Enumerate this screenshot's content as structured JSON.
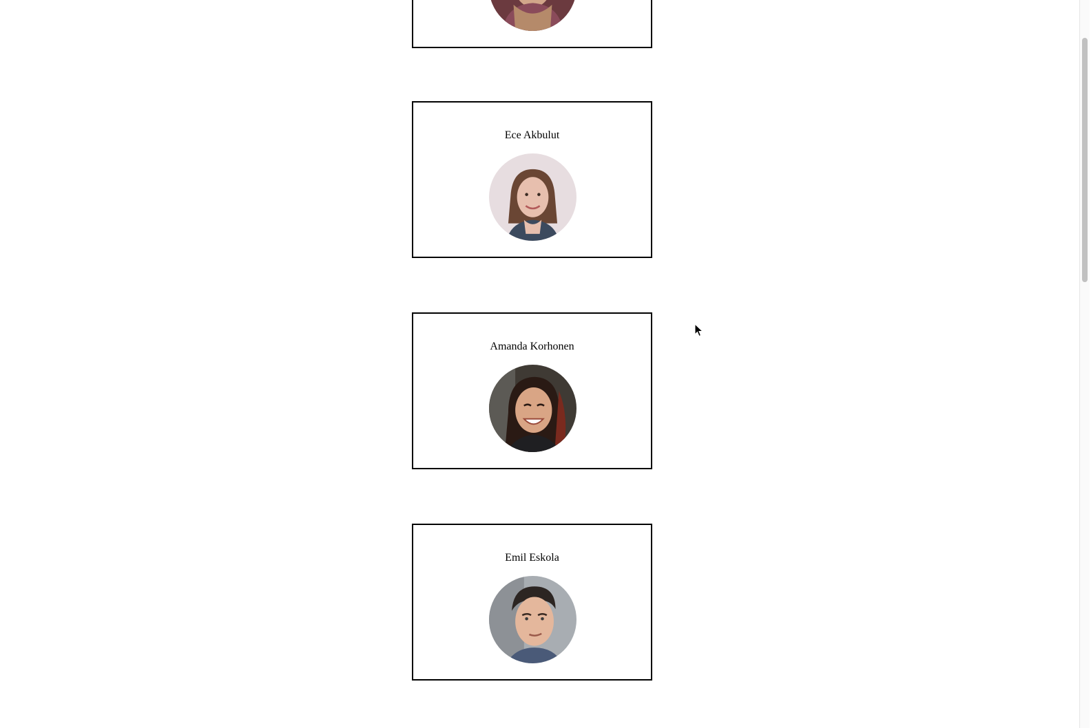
{
  "people": [
    {
      "name": "",
      "avatar": "woman-scarf-photo"
    },
    {
      "name": "Ece Akbulut",
      "avatar": "woman-brown-hair-photo"
    },
    {
      "name": "Amanda Korhonen",
      "avatar": "woman-smiling-photo"
    },
    {
      "name": "Emil Eskola",
      "avatar": "man-portrait-photo"
    }
  ],
  "colors": {
    "card_border": "#000000",
    "background": "#ffffff",
    "scrollbar_thumb": "#c1c1c1"
  }
}
